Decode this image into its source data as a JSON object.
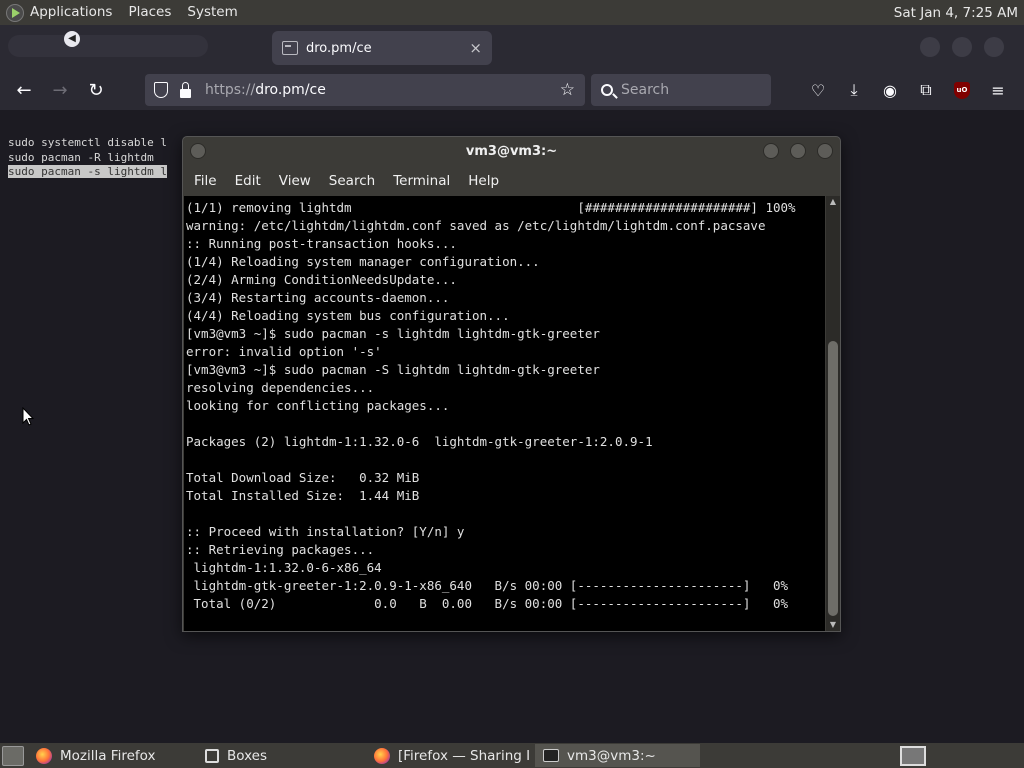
{
  "top_panel": {
    "menus": [
      "Applications",
      "Places",
      "System"
    ],
    "clock": "Sat Jan  4,  7:25 AM"
  },
  "browser": {
    "tab_title": "dro.pm/ce",
    "tab_close": "×",
    "url_prefix": "https://",
    "url_host": "dro.pm/ce",
    "search_placeholder": "Search",
    "ublock_label": "uO"
  },
  "page": {
    "lines": [
      "sudo systemctl disable l",
      "sudo pacman -R lightdm",
      "sudo pacman -s lightdm l"
    ]
  },
  "terminal": {
    "title": "vm3@vm3:~",
    "menu": [
      "File",
      "Edit",
      "View",
      "Search",
      "Terminal",
      "Help"
    ],
    "output": "(1/1) removing lightdm                              [######################] 100%\nwarning: /etc/lightdm/lightdm.conf saved as /etc/lightdm/lightdm.conf.pacsave\n:: Running post-transaction hooks...\n(1/4) Reloading system manager configuration...\n(2/4) Arming ConditionNeedsUpdate...\n(3/4) Restarting accounts-daemon...\n(4/4) Reloading system bus configuration...\n[vm3@vm3 ~]$ sudo pacman -s lightdm lightdm-gtk-greeter\nerror: invalid option '-s'\n[vm3@vm3 ~]$ sudo pacman -S lightdm lightdm-gtk-greeter\nresolving dependencies...\nlooking for conflicting packages...\n\nPackages (2) lightdm-1:1.32.0-6  lightdm-gtk-greeter-1:2.0.9-1\n\nTotal Download Size:   0.32 MiB\nTotal Installed Size:  1.44 MiB\n\n:: Proceed with installation? [Y/n] y\n:: Retrieving packages...\n lightdm-1:1.32.0-6-x86_64\n lightdm-gtk-greeter-1:2.0.9-1-x86_640   B/s 00:00 [----------------------]   0%\n Total (0/2)             0.0   B  0.00   B/s 00:00 [----------------------]   0%"
  },
  "taskbar": {
    "tasks": [
      {
        "label": "Mozilla Firefox",
        "icon": "firefox-icon"
      },
      {
        "label": "Boxes",
        "icon": "boxes-icon"
      },
      {
        "label": "[Firefox — Sharing I...",
        "icon": "firefox-icon"
      },
      {
        "label": "vm3@vm3:~",
        "icon": "terminal-icon"
      }
    ]
  },
  "colors": {
    "panel": "#3c3b37",
    "browser_chrome": "#2b2a33",
    "terminal_bg": "#000000",
    "page_bg": "#1c1b22"
  }
}
